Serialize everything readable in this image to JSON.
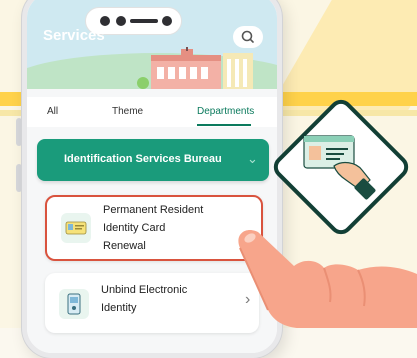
{
  "app": {
    "title": "Services"
  },
  "tabs": {
    "all": "All",
    "theme": "Theme",
    "departments": "Departments"
  },
  "bureau": {
    "label": "Identification Services Bureau"
  },
  "services": [
    {
      "lines": [
        "Permanent Resident",
        "Identity Card",
        "Renewal"
      ]
    },
    {
      "lines": [
        "Unbind Electronic",
        "Identity"
      ]
    }
  ],
  "icons": {
    "search": "search-icon",
    "chevron": "chevron-right-icon",
    "id_card": "id-card-icon",
    "e_id": "electronic-id-icon"
  },
  "colors": {
    "accent": "#1a9b7b",
    "highlight_border": "#d9533e",
    "background": "#fbf6e4",
    "strip": "#ffd24a"
  }
}
